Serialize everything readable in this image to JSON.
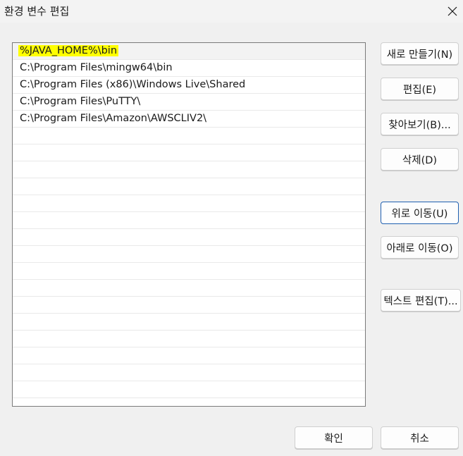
{
  "window": {
    "title": "환경 변수 편집"
  },
  "list": {
    "items": [
      "%JAVA_HOME%\\bin",
      "C:\\Program Files\\mingw64\\bin",
      "C:\\Program Files (x86)\\Windows Live\\Shared",
      "C:\\Program Files\\PuTTY\\",
      "C:\\Program Files\\Amazon\\AWSCLIV2\\"
    ],
    "selected_index": 0,
    "highlight_color": "#ffff00"
  },
  "buttons": {
    "new": "새로 만들기(N)",
    "edit": "편집(E)",
    "browse": "찾아보기(B)...",
    "delete": "삭제(D)",
    "move_up": "위로 이동(U)",
    "move_down": "아래로 이동(O)",
    "edit_text": "텍스트 편집(T)...",
    "ok": "확인",
    "cancel": "취소"
  },
  "icons": {
    "close": "close-icon"
  }
}
